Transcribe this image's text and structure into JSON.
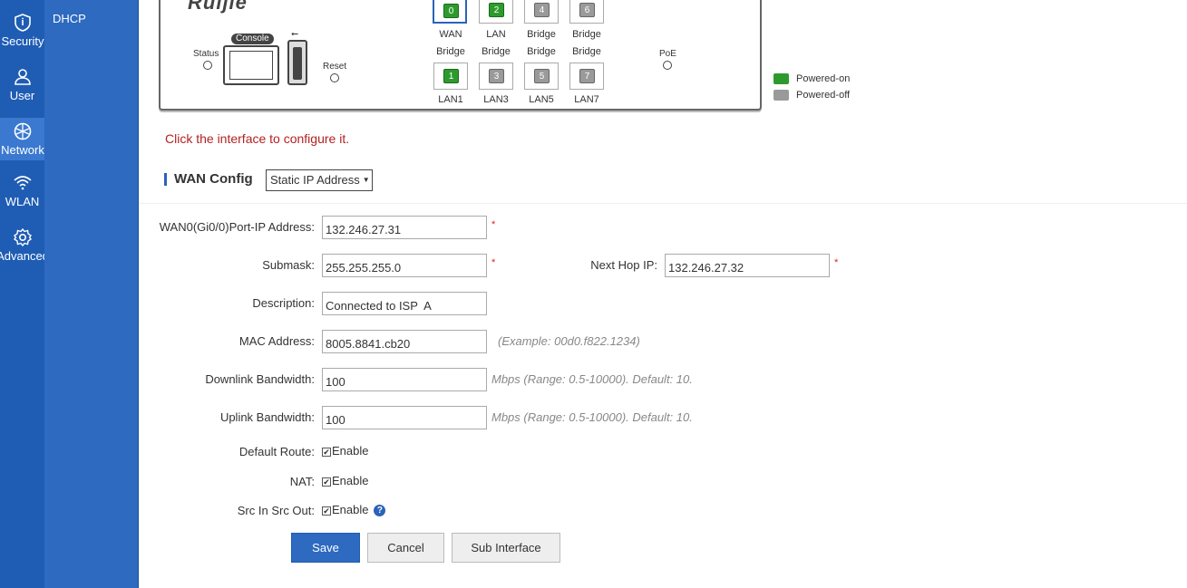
{
  "rail": {
    "items": [
      {
        "label": "Security",
        "icon": "shield-icon"
      },
      {
        "label": "User",
        "icon": "user-icon"
      },
      {
        "label": "Network",
        "icon": "globe-icon",
        "active": true
      },
      {
        "label": "WLAN",
        "icon": "wifi-icon"
      },
      {
        "label": "Advanced",
        "icon": "gear-icon"
      }
    ]
  },
  "subnav": {
    "dhcp_label": "DHCP"
  },
  "device": {
    "brand": "Ruijie",
    "status_label": "Status",
    "console_label": "Console",
    "reset_label": "Reset",
    "poe_label": "PoE",
    "usb_symbol": "⭠",
    "ports_top": [
      {
        "num": "0",
        "state": "on",
        "selected": true,
        "label1": "WAN",
        "label2": "Bridge"
      },
      {
        "num": "2",
        "state": "on",
        "label1": "LAN",
        "label2": "Bridge"
      },
      {
        "num": "4",
        "state": "off",
        "label1": "Bridge",
        "label2": "Bridge"
      },
      {
        "num": "6",
        "state": "off",
        "label1": "Bridge",
        "label2": "Bridge"
      }
    ],
    "ports_bottom": [
      {
        "num": "1",
        "state": "on",
        "label": "LAN1"
      },
      {
        "num": "3",
        "state": "off",
        "label": "LAN3"
      },
      {
        "num": "5",
        "state": "off",
        "label": "LAN5"
      },
      {
        "num": "7",
        "state": "off",
        "label": "LAN7"
      }
    ]
  },
  "legend": {
    "powered_on": "Powered-on",
    "powered_off": "Powered-off",
    "on_color": "#2e9a2e",
    "off_color": "#9a9a9a"
  },
  "hint": "Click the interface to configure it.",
  "section": {
    "title": "WAN Config",
    "mode": "Static IP Address"
  },
  "form": {
    "ip_label": "WAN0(Gi0/0)Port-IP Address:",
    "ip_value": "132.246.27.31",
    "submask_label": "Submask:",
    "submask_value": "255.255.255.0",
    "nexthop_label": "Next Hop IP:",
    "nexthop_value": "132.246.27.32",
    "desc_label": "Description:",
    "desc_value": "Connected to ISP  A",
    "mac_label": "MAC Address:",
    "mac_value": "8005.8841.cb20",
    "mac_help": "(Example: 00d0.f822.1234)",
    "down_label": "Downlink Bandwidth:",
    "down_value": "100",
    "down_help": "Mbps (Range: 0.5-10000). Default: 10.",
    "up_label": "Uplink Bandwidth:",
    "up_value": "100",
    "up_help": "Mbps (Range: 0.5-10000). Default: 10.",
    "route_label": "Default Route:",
    "nat_label": "NAT:",
    "srcin_label": "Src In Src Out:",
    "enable_label": "Enable",
    "required_mark": "*",
    "help_mark": "?"
  },
  "buttons": {
    "save": "Save",
    "cancel": "Cancel",
    "sub_interface": "Sub Interface"
  }
}
